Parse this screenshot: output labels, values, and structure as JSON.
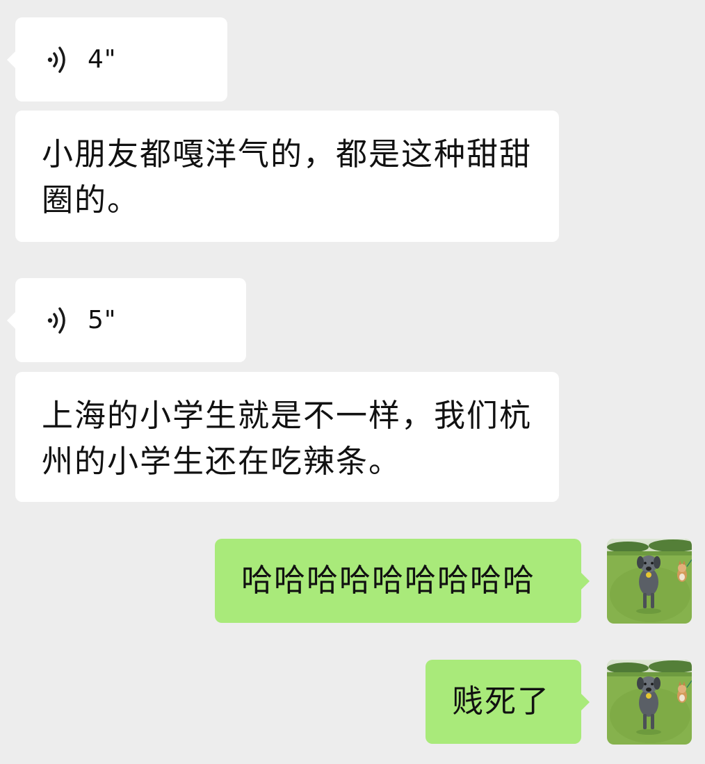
{
  "messages": [
    {
      "side": "left",
      "type": "voice",
      "duration": "4\""
    },
    {
      "side": "left",
      "type": "text",
      "text": "小朋友都嘎洋气的，都是这种甜甜圈的。"
    },
    {
      "side": "left",
      "type": "voice",
      "duration": "5\""
    },
    {
      "side": "left",
      "type": "text",
      "text": "上海的小学生就是不一样，我们杭州的小学生还在吃辣条。"
    },
    {
      "side": "right",
      "type": "text",
      "text": "哈哈哈哈哈哈哈哈哈"
    },
    {
      "side": "right",
      "type": "text",
      "text": "贱死了"
    }
  ],
  "colors": {
    "background": "#ededed",
    "incoming_bubble": "#ffffff",
    "outgoing_bubble": "#a9ea7a"
  },
  "icons": {
    "voice": "voice-wave-icon",
    "avatar": "dog-avatar-photo"
  }
}
